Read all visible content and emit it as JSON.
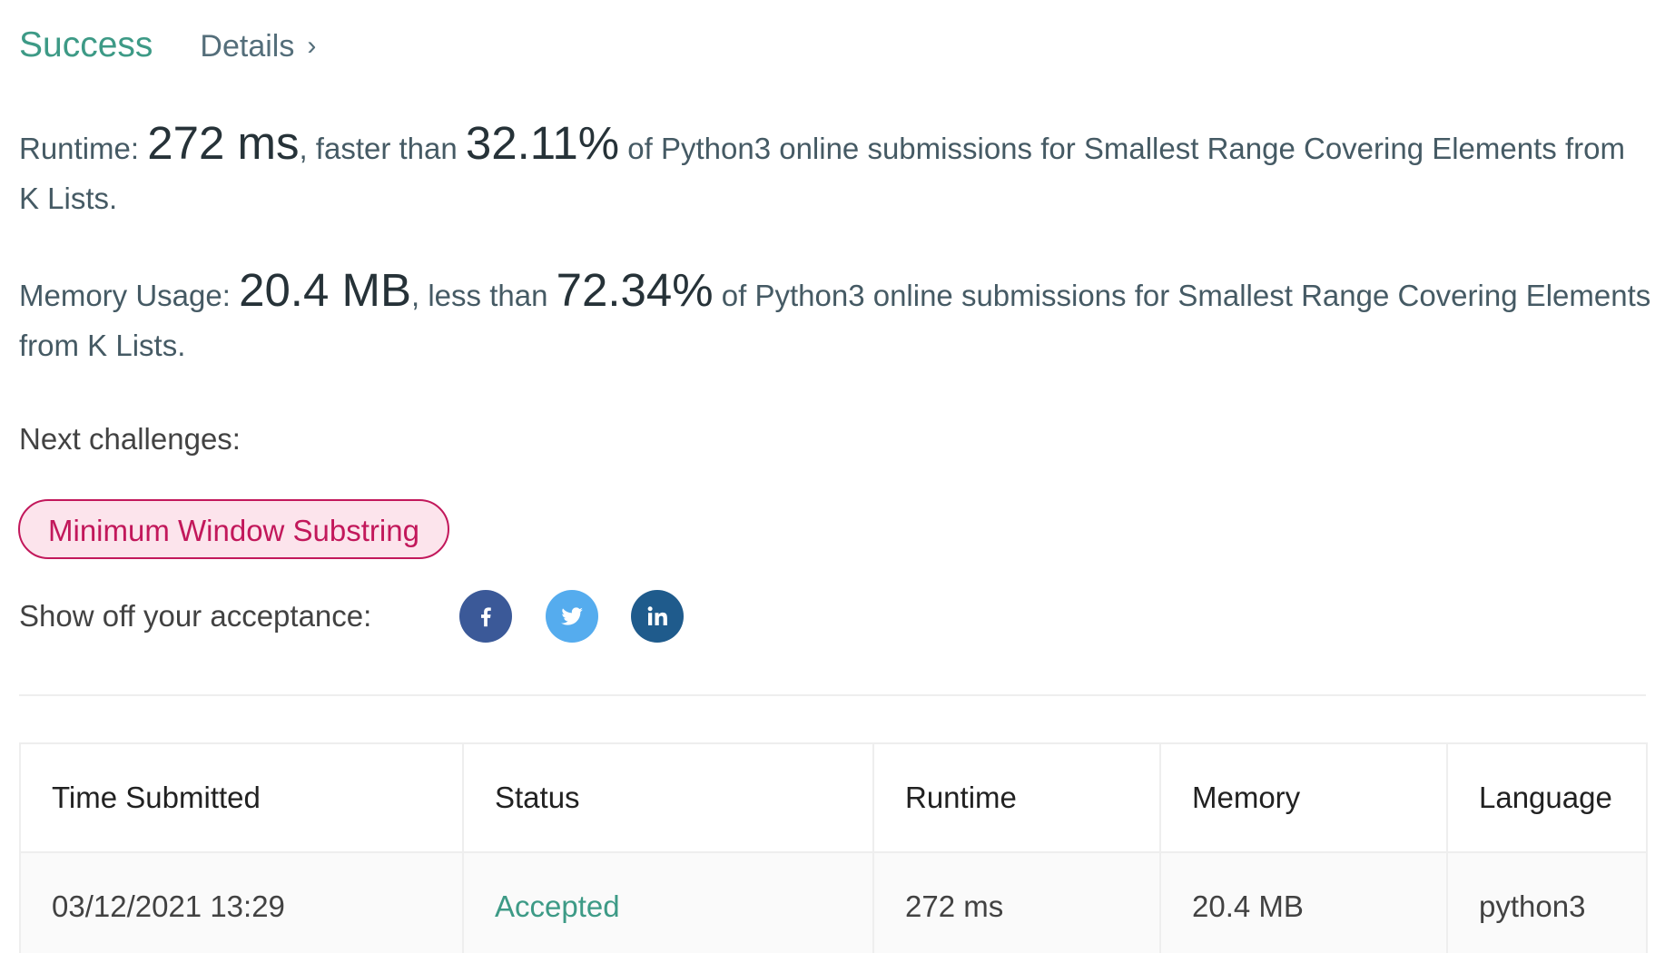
{
  "header": {
    "status": "Success",
    "details_label": "Details",
    "chevron": "›"
  },
  "runtime_stat": {
    "label": "Runtime: ",
    "value": "272 ms",
    "mid_text": ", faster than ",
    "percent": "32.11%",
    "tail_text": " of Python3 online submissions for Smallest Range Covering Elements from K Lists."
  },
  "memory_stat": {
    "label": "Memory Usage: ",
    "value": "20.4 MB",
    "mid_text": ", less than ",
    "percent": "72.34%",
    "tail_text": " of Python3 online submissions for Smallest Range Covering Elements from K Lists."
  },
  "next": {
    "label": "Next challenges:",
    "challenges": [
      "Minimum Window Substring"
    ]
  },
  "share": {
    "label": "Show off your acceptance:",
    "icons": [
      "facebook-icon",
      "twitter-icon",
      "linkedin-icon"
    ],
    "colors": {
      "facebook": "#3b5998",
      "twitter": "#55acee",
      "linkedin": "#1f5b8c"
    }
  },
  "table": {
    "headers": [
      "Time Submitted",
      "Status",
      "Runtime",
      "Memory",
      "Language"
    ],
    "rows": [
      [
        "03/12/2021 13:29",
        "Accepted",
        "272 ms",
        "20.4 MB",
        "python3"
      ]
    ]
  },
  "colors": {
    "success": "#3d9a86",
    "challenge_border": "#c2185b",
    "challenge_bg": "#fce4ec"
  }
}
